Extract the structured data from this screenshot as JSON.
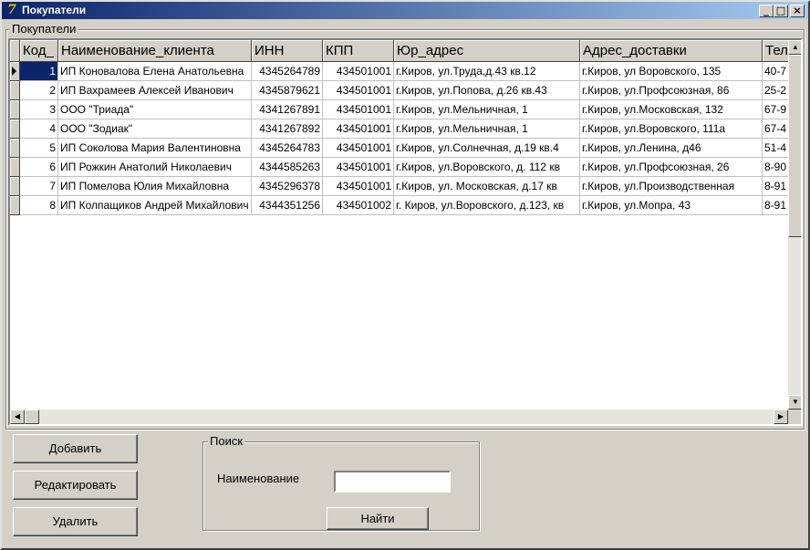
{
  "window": {
    "title": "Покупатели"
  },
  "groupbox": {
    "label": "Покупатели"
  },
  "grid": {
    "columns": [
      "Код_",
      "Наименование_клиента",
      "ИНН",
      "КПП",
      "Юр_адрес",
      "Адрес_доставки",
      "Тел"
    ],
    "rows": [
      [
        "1",
        "ИП Коновалова Елена Анатольевна",
        "4345264789",
        "434501001",
        "г.Киров, ул.Труда,д.43 кв.12",
        "г.Киров, ул Воровского, 135",
        "40-7"
      ],
      [
        "2",
        "ИП Вахрамеев Алексей Иванович",
        "4345879621",
        "434501001",
        "г.Киров, ул.Попова, д.26 кв.43",
        "г.Киров, ул.Профсоюзная, 86",
        "25-2"
      ],
      [
        "3",
        "ООО \"Триада\"",
        "4341267891",
        "434501001",
        "г.Киров, ул.Мельничная, 1",
        "г.Киров, ул.Московская, 132",
        "67-9"
      ],
      [
        "4",
        "ООО \"Зодиак\"",
        "4341267892",
        "434501001",
        "г.Киров, ул.Мельничная, 1",
        "г.Киров, ул.Воровского, 111а",
        "67-4"
      ],
      [
        "5",
        "ИП Соколова Мария Валентиновна",
        "4345264783",
        "434501001",
        "г.Киров, ул.Солнечная, д.19 кв.4",
        "г.Киров, ул.Ленина, д46",
        "51-4"
      ],
      [
        "6",
        "ИП Рожкин Анатолий Николаевич",
        "4344585263",
        "434501001",
        "г.Киров, ул.Воровского, д. 112 кв",
        "г.Киров, ул.Профсоюзная, 26",
        "8-90"
      ],
      [
        "7",
        "ИП Помелова Юлия Михайловна",
        "4345296378",
        "434501001",
        "г.Киров, ул. Московская, д.17 кв",
        "г.Киров, ул.Производственная",
        "8-91"
      ],
      [
        "8",
        "ИП Колпащиков Андрей Михайлович",
        "4344351256",
        "434501002",
        "г. Киров, ул.Воровского, д.123, кв",
        "г.Киров, ул.Мопра, 43",
        "8-91"
      ]
    ]
  },
  "buttons": {
    "add": "Добавить",
    "edit": "Редактировать",
    "delete": "Удалить",
    "find": "Найти"
  },
  "search": {
    "group_label": "Поиск",
    "field_label": "Наименование",
    "value": ""
  },
  "colors": {
    "title_start": "#0a246a",
    "title_end": "#a6caf0",
    "selection": "#0a246a",
    "face": "#d4d0c8"
  }
}
